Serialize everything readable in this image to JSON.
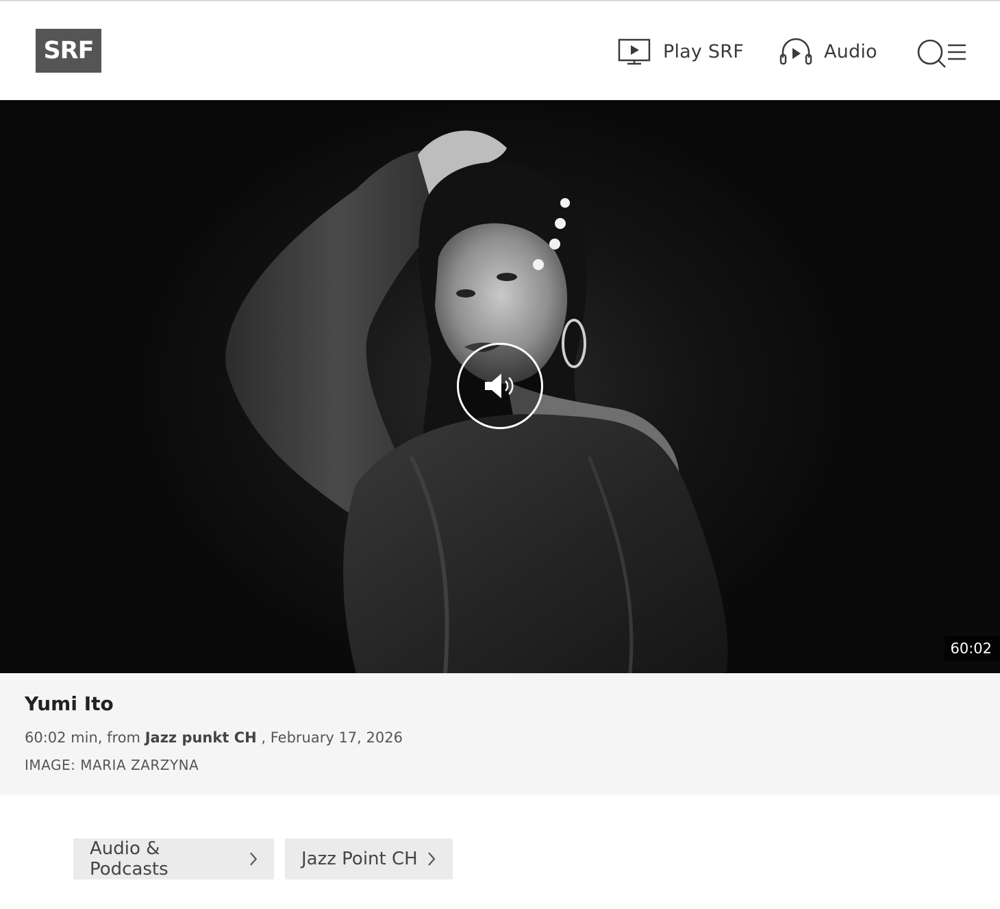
{
  "header": {
    "logo_text": "SRF",
    "nav": [
      {
        "label": "Play SRF",
        "icon": "tv-play-icon"
      },
      {
        "label": "Audio",
        "icon": "headphones-play-icon"
      }
    ],
    "search_menu_icon": "search-menu-icon"
  },
  "media": {
    "duration": "60:02",
    "play_icon": "speaker-icon"
  },
  "episode": {
    "title": "Yumi Ito",
    "meta_prefix": "60:02 min, from ",
    "show": "Jazz punkt CH",
    "meta_suffix": " , February 17, 2026",
    "image_credit": "IMAGE: MARIA ZARZYNA"
  },
  "breadcrumbs": [
    {
      "label": "Audio & Podcasts"
    },
    {
      "label": "Jazz Point CH"
    }
  ],
  "colors": {
    "logo_bg": "#555555",
    "info_bg": "#f5f5f5",
    "crumb_bg": "#ebebeb"
  }
}
